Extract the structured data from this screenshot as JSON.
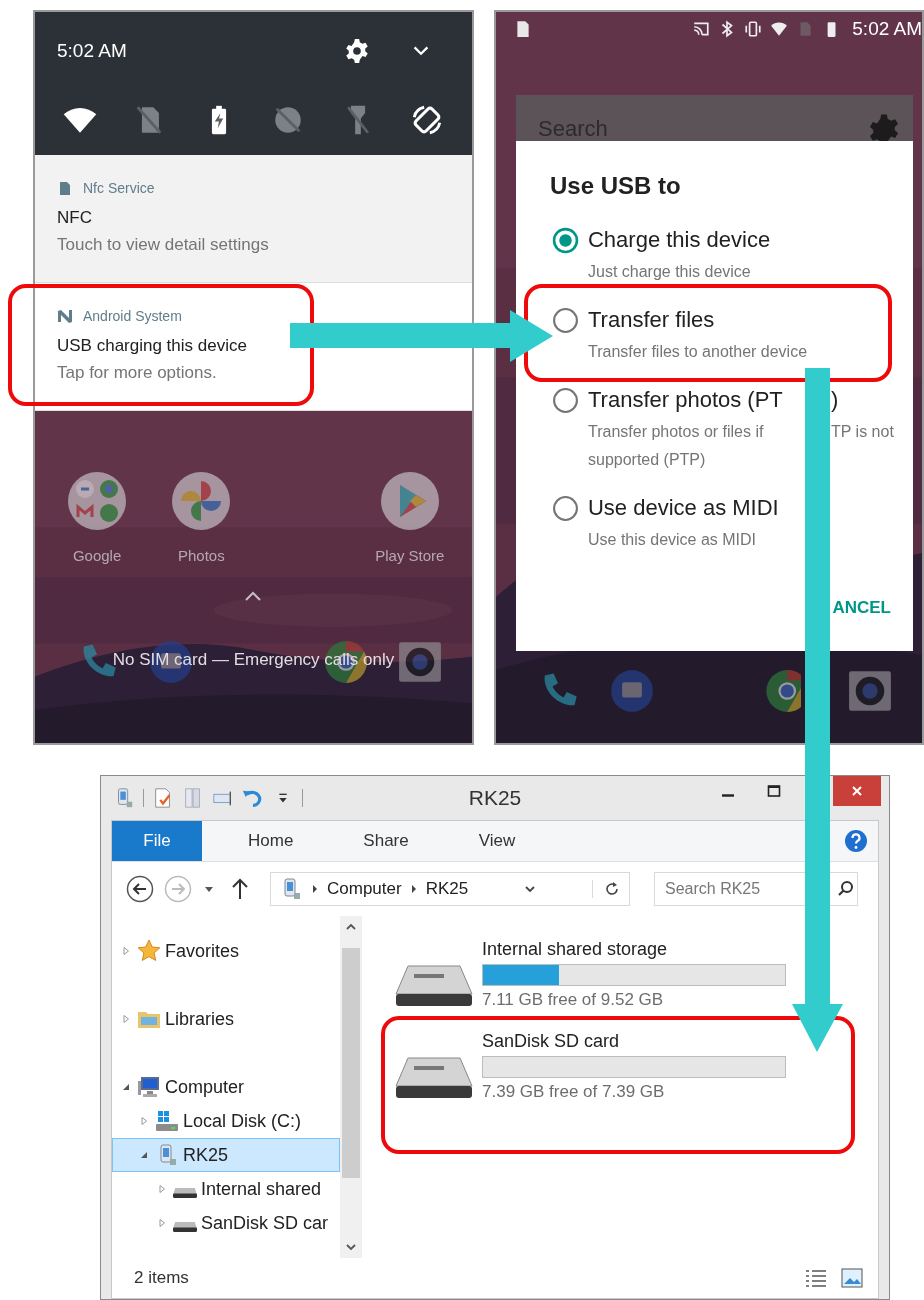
{
  "notification_shade": {
    "time": "5:02 AM",
    "quick_settings": [
      {
        "kind": "wifi",
        "on": true
      },
      {
        "kind": "sim",
        "on": false
      },
      {
        "kind": "battery",
        "on": true
      },
      {
        "kind": "dnd",
        "on": false
      },
      {
        "kind": "flashlight",
        "on": false
      },
      {
        "kind": "rotate",
        "on": true
      }
    ],
    "notifications": [
      {
        "kind": "nfc",
        "app": "Nfc Service",
        "title": "NFC",
        "text": "Touch to view detail settings"
      },
      {
        "kind": "system",
        "app": "Android System",
        "title": "USB charging this device",
        "text": "Tap for more options."
      }
    ],
    "home_apps": [
      {
        "kind": "folder",
        "label": "Google"
      },
      {
        "kind": "photos",
        "label": "Photos"
      },
      {
        "kind": "store",
        "label": "Play Store"
      }
    ],
    "lock_message": "No SIM card — Emergency calls only"
  },
  "usb_screen": {
    "time": "5:02 AM",
    "search_placeholder": "Search",
    "dialog": {
      "title": "Use USB to",
      "options": [
        {
          "selected": true,
          "title_parts": [
            "Charge this device"
          ],
          "description_lines": [
            [
              "Just charge this device"
            ]
          ]
        },
        {
          "selected": false,
          "title_parts": [
            "Transfer files"
          ],
          "description_lines": [
            [
              "Transfer files to another device"
            ]
          ]
        },
        {
          "selected": false,
          "title_parts": [
            "Transfer photos (PT",
            ")"
          ],
          "description_lines": [
            [
              "Transfer photos or files if",
              "TP is not"
            ],
            [
              "supported (PTP)"
            ]
          ]
        },
        {
          "selected": false,
          "title_parts": [
            "Use device as MIDI"
          ],
          "description_lines": [
            [
              "Use this device as MIDI"
            ]
          ]
        }
      ],
      "button": "ANCEL"
    }
  },
  "explorer": {
    "title": "RK25",
    "ribbon_tabs": [
      {
        "kind": "menu",
        "label": "File"
      },
      {
        "kind": "tab",
        "label": "Home"
      },
      {
        "kind": "tab",
        "label": "Share"
      },
      {
        "kind": "tab",
        "label": "View"
      }
    ],
    "address": [
      "Computer",
      "RK25"
    ],
    "search": {
      "placeholder": "Search RK25"
    },
    "tree": [
      {
        "kind": "favorites",
        "label": "Favorites",
        "expanded": false,
        "selected": false
      },
      {
        "kind": "libraries",
        "label": "Libraries",
        "expanded": false,
        "selected": false
      },
      {
        "kind": "computer",
        "label": "Computer",
        "expanded": true,
        "selected": false,
        "children": [
          {
            "kind": "system_disk",
            "label": "Local Disk (C:)",
            "expanded": false,
            "selected": false
          },
          {
            "kind": "device",
            "label": "RK25",
            "expanded": true,
            "selected": true,
            "children": [
              {
                "kind": "drive",
                "label": "Internal shared",
                "expanded": false,
                "selected": false
              },
              {
                "kind": "drive",
                "label": "SanDisk SD car",
                "expanded": false,
                "selected": false
              }
            ]
          }
        ]
      }
    ],
    "drives": [
      {
        "name": "Internal shared storage",
        "level": 0.25,
        "free": "7.11 GB free of 9.52 GB"
      },
      {
        "name": "SanDisk SD card",
        "level": 0,
        "free": "7.39 GB free of 7.39 GB"
      }
    ],
    "status": "2 items"
  }
}
